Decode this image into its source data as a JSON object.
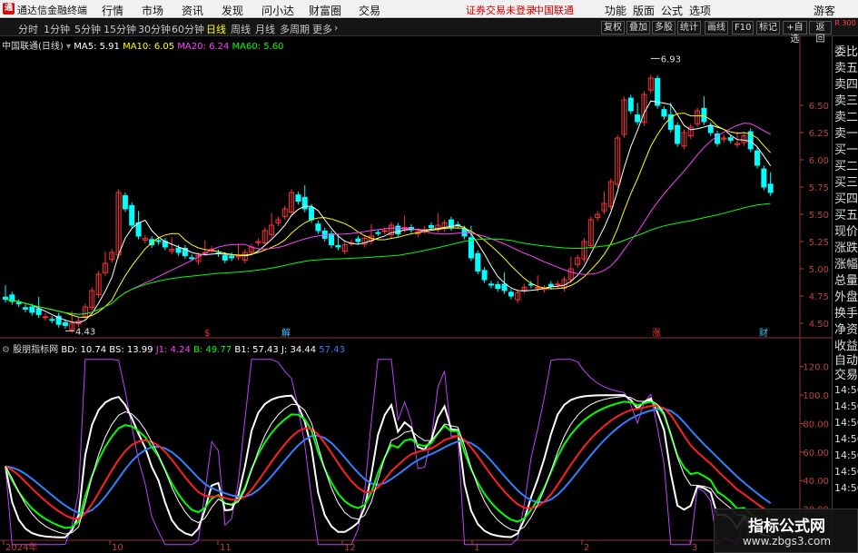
{
  "menubar": {
    "logo": "通",
    "app_title": "通达信金融终端",
    "items": [
      "行情",
      "市场",
      "资讯",
      "发现",
      "问小达",
      "财富圈",
      "交易"
    ],
    "notice": "证券交易未登录",
    "stock_name": "中国联通",
    "right_items": [
      "功能",
      "版面",
      "公式",
      "选项"
    ],
    "visitor": "游客"
  },
  "toolbar": {
    "periods": [
      "分时",
      "1分钟",
      "5分钟",
      "15分钟",
      "30分钟",
      "60分钟",
      "日线",
      "周线",
      "月线",
      "多周期",
      "更多"
    ],
    "active_period": "日线",
    "right_buttons": [
      "复权",
      "叠加",
      "多股",
      "统计",
      "画线",
      "F10",
      "标记",
      "+自选",
      "返回"
    ],
    "right_indicator": "R 300"
  },
  "main_legend": {
    "label": "中国联通(日线)",
    "items": [
      {
        "name": "MA5",
        "value": "5.91",
        "color": "#ffffff"
      },
      {
        "name": "MA10",
        "value": "6.05",
        "color": "#ffff00"
      },
      {
        "name": "MA20",
        "value": "6.24",
        "color": "#ff40ff"
      },
      {
        "name": "MA60",
        "value": "5.60",
        "color": "#00ff00"
      }
    ]
  },
  "sub_legend": {
    "label": "股朋指标网",
    "items": [
      {
        "name": "BD",
        "value": "10.74",
        "color": "#ffffff"
      },
      {
        "name": "BS",
        "value": "13.99",
        "color": "#ffffff"
      },
      {
        "name": "J1",
        "value": "4.24",
        "color": "#ff40ff"
      },
      {
        "name": "B",
        "value": "49.77",
        "color": "#00ff00"
      },
      {
        "name": "B1",
        "value": "57.43",
        "color": "#ffffff"
      },
      {
        "name": "J",
        "value": "34.44",
        "color": "#ffffff"
      },
      {
        "name": "",
        "value": "57.43",
        "color": "#3080ff"
      }
    ]
  },
  "price_axis": [
    "6.50",
    "6.25",
    "6.00",
    "5.75",
    "5.50",
    "5.25",
    "5.00",
    "4.75",
    "4.50"
  ],
  "osc_axis": [
    "120.0",
    "100.0",
    "80.00",
    "60.00",
    "40.00",
    "20.00"
  ],
  "date_axis": [
    "2024年",
    "10",
    "11",
    "12",
    "1",
    "2",
    "3"
  ],
  "annotations": {
    "high": "6.93",
    "low": "4.43"
  },
  "event_marks": [
    "$",
    "解",
    "涨",
    "财"
  ],
  "right_panel": {
    "items": [
      "委比",
      "卖五",
      "卖四",
      "卖三",
      "卖二",
      "卖一",
      "买一",
      "买二",
      "买三",
      "买四",
      "买五",
      "现价",
      "涨跌",
      "涨幅",
      "总量",
      "外盘",
      "换手",
      "净资",
      "收益"
    ],
    "trade": [
      "自动",
      "交易"
    ],
    "times": [
      "14:56",
      "14:56",
      "14:56",
      "14:56",
      "14:56",
      "14:56",
      "14:56"
    ]
  },
  "watermark": {
    "title": "指标公式网",
    "url": "www.zbgs3.com"
  },
  "colors": {
    "up": "#ff3232",
    "down": "#00ffff",
    "ma5": "#ffffff",
    "ma10": "#ffff00",
    "ma20": "#ff40ff",
    "ma60": "#00ff00"
  },
  "chart_data": {
    "type": "candlestick",
    "x_labels": [
      "2024年",
      "10",
      "11",
      "12",
      "1",
      "2",
      "3"
    ],
    "ylim": [
      4.4,
      7.0
    ],
    "high": 6.93,
    "low": 4.43,
    "close_points": [
      4.72,
      4.7,
      4.68,
      4.63,
      4.6,
      4.58,
      4.56,
      4.53,
      4.49,
      4.48,
      4.5,
      4.52,
      4.65,
      4.8,
      4.95,
      5.05,
      5.15,
      5.7,
      5.55,
      5.4,
      5.3,
      5.28,
      5.22,
      5.25,
      5.2,
      5.18,
      5.15,
      5.12,
      5.1,
      5.12,
      5.15,
      5.18,
      5.14,
      5.08,
      5.1,
      5.12,
      5.15,
      5.2,
      5.25,
      5.35,
      5.4,
      5.45,
      5.55,
      5.7,
      5.62,
      5.55,
      5.45,
      5.35,
      5.28,
      5.22,
      5.2,
      5.22,
      5.24,
      5.25,
      5.28,
      5.3,
      5.33,
      5.35,
      5.4,
      5.32,
      5.38,
      5.36,
      5.34,
      5.36,
      5.38,
      5.4,
      5.42,
      5.38,
      5.4,
      5.3,
      5.1,
      4.98,
      4.9,
      4.85,
      4.82,
      4.8,
      4.75,
      4.78,
      4.83,
      4.85,
      4.83,
      4.82,
      4.84,
      4.86,
      4.9,
      5.0,
      5.1,
      5.25,
      5.45,
      5.5,
      5.6,
      5.8,
      6.2,
      6.55,
      6.45,
      6.35,
      6.6,
      6.75,
      6.5,
      6.4,
      6.28,
      6.15,
      6.25,
      6.3,
      6.45,
      6.35,
      6.25,
      6.15,
      6.2,
      6.18,
      6.15,
      6.22,
      6.1,
      5.95,
      5.75,
      5.7
    ],
    "series": [
      {
        "name": "MA5",
        "value_last": 5.91
      },
      {
        "name": "MA10",
        "value_last": 6.05
      },
      {
        "name": "MA20",
        "value_last": 6.24
      },
      {
        "name": "MA60",
        "value_last": 5.6
      }
    ]
  }
}
